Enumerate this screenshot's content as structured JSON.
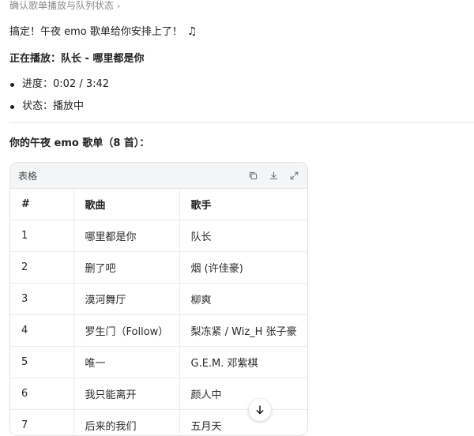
{
  "breadcrumb": {
    "text": "确认歌单播放与队列状态"
  },
  "message": {
    "intro": "搞定！午夜 emo 歌单给你安排上了！",
    "now_playing": "正在播放：队长 - 哪里都是你",
    "bullets": [
      "进度：0:02 / 3:42",
      "状态：播放中"
    ],
    "list_title": "你的午夜 emo 歌单（8 首）："
  },
  "table": {
    "label": "表格",
    "headers": [
      "#",
      "歌曲",
      "歌手"
    ],
    "rows": [
      [
        "1",
        "哪里都是你",
        "队长"
      ],
      [
        "2",
        "删了吧",
        "烟 (许佳豪)"
      ],
      [
        "3",
        "漠河舞厅",
        "柳爽"
      ],
      [
        "4",
        "罗生门（Follow）",
        "梨冻紧 / Wiz_H 张子豪"
      ],
      [
        "5",
        "唯一",
        "G.E.M. 邓紫棋"
      ],
      [
        "6",
        "我只能离开",
        "颜人中"
      ],
      [
        "7",
        "后来的我们",
        "五月天"
      ]
    ]
  },
  "icons": {
    "music": "music-note-icon",
    "copy": "copy-icon",
    "download": "download-icon",
    "expand": "expand-icon",
    "scroll": "arrow-down-icon",
    "chevron": "chevron-right-icon"
  }
}
